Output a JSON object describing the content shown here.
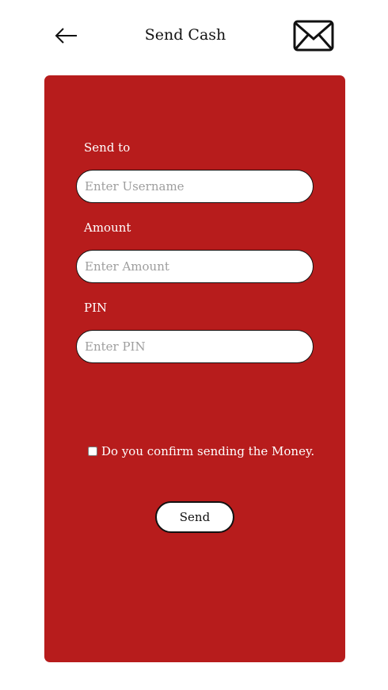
{
  "header": {
    "title": "Send Cash",
    "back_icon": "arrow-left",
    "mail_icon": "envelope"
  },
  "form": {
    "send_to": {
      "label": "Send to",
      "placeholder": "Enter Username",
      "value": ""
    },
    "amount": {
      "label": "Amount",
      "placeholder": "Enter Amount",
      "value": ""
    },
    "pin": {
      "label": "PIN",
      "placeholder": "Enter PIN",
      "value": ""
    },
    "confirm": {
      "label": "Do you confirm sending the Money.",
      "checked": false
    },
    "send_button": "Send"
  },
  "colors": {
    "card_background": "#b71c1c",
    "page_background": "#ffffff",
    "text_on_card": "#ffffff"
  }
}
